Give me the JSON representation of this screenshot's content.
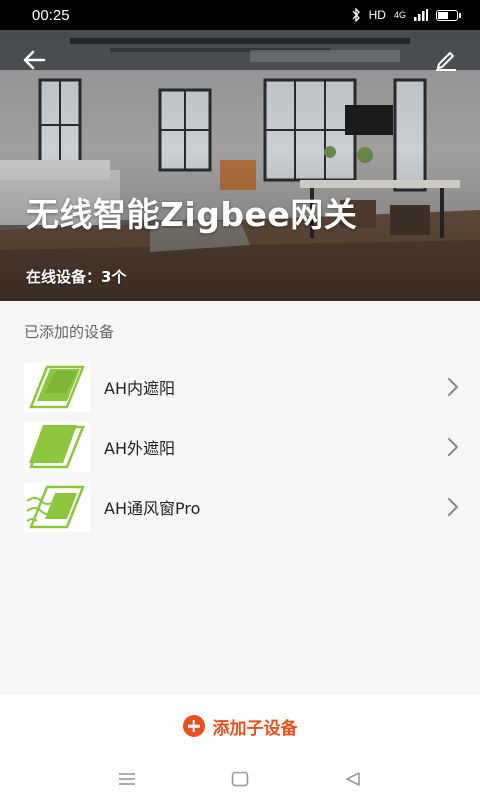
{
  "status_bar": {
    "time": "00:25",
    "network": "HD",
    "signal": "4G",
    "battery_level": 0.6
  },
  "header": {
    "title": "无线智能Zigbee网关",
    "online_devices": "在线设备：3个"
  },
  "section": {
    "label": "已添加的设备"
  },
  "devices": [
    {
      "name": "AH内遮阳",
      "icon": "inner-shade-icon"
    },
    {
      "name": "AH外遮阳",
      "icon": "outer-shade-icon"
    },
    {
      "name": "AH通风窗Pro",
      "icon": "ventilation-window-icon"
    }
  ],
  "add_button": {
    "label": "添加子设备"
  },
  "colors": {
    "accent": "#e8501e",
    "icon_green": "#8cc63f"
  }
}
